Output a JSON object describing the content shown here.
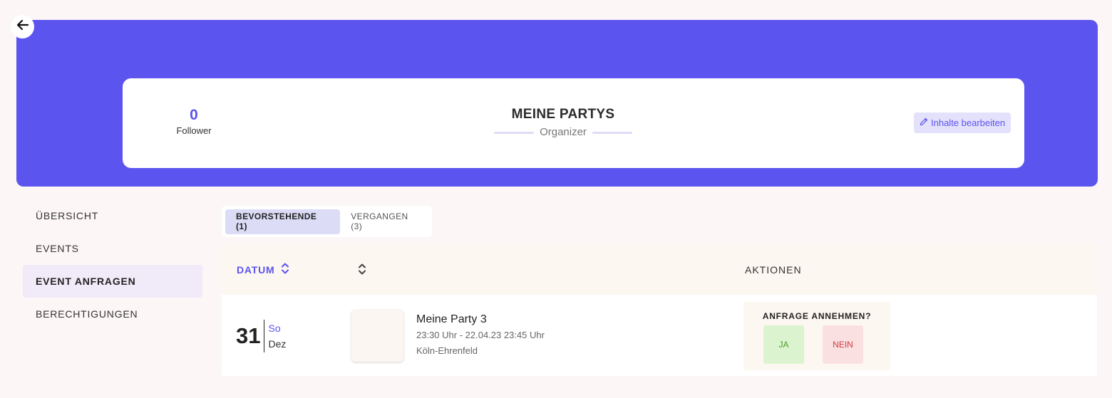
{
  "header": {
    "followers_count": "0",
    "followers_label": "Follower",
    "profile_name": "MEINE PARTYS",
    "profile_role": "Organizer",
    "edit_label": "Inhalte bearbeiten"
  },
  "sidebar": {
    "items": [
      {
        "label": "ÜBERSICHT",
        "active": false
      },
      {
        "label": "EVENTS",
        "active": false
      },
      {
        "label": "EVENT ANFRAGEN",
        "active": true
      },
      {
        "label": "BERECHTIGUNGEN",
        "active": false
      }
    ]
  },
  "tabs": [
    {
      "label": "BEVORSTEHENDE (1)",
      "active": true
    },
    {
      "label": "VERGANGEN (3)",
      "active": false
    }
  ],
  "table": {
    "col_datum": "DATUM",
    "col_actions": "AKTIONEN",
    "rows": [
      {
        "day": "31",
        "weekday": "So",
        "month": "Dez",
        "event_name": "Meine Party 3",
        "event_time": "23:30 Uhr - 22.04.23 23:45 Uhr",
        "event_location": "Köln-Ehrenfeld",
        "request_question": "ANFRAGE ANNEHMEN?",
        "yes_label": "JA",
        "no_label": "NEIN"
      }
    ]
  },
  "colors": {
    "accent": "#5b54ef",
    "background": "#fcf6f6",
    "yes_bg": "#dcf3d0",
    "no_bg": "#fbe0e2"
  },
  "icons": {
    "back": "arrow-left-icon",
    "edit": "pencil-icon",
    "sort": "sort-icon"
  }
}
